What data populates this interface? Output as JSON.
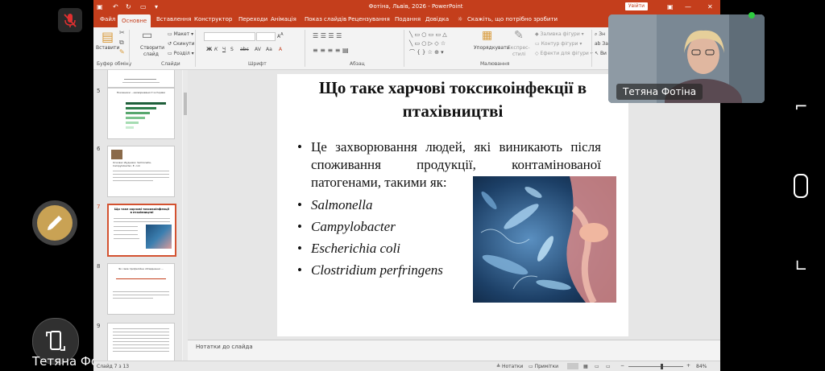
{
  "window": {
    "title": "Фотіна, Львів, 2026  -  PowerPoint",
    "share_button": "Увійти"
  },
  "ribbon_tabs": [
    "Файл",
    "Основне",
    "Вставлення",
    "Конструктор",
    "Переходи",
    "Анімація",
    "Показ слайдів",
    "Рецензування",
    "Подання",
    "Довідка"
  ],
  "active_tab": "Основне",
  "tell_me": "Скажіть, що потрібно зробити",
  "ribbon": {
    "paste": "Вставити",
    "new_slide_1": "Створити",
    "new_slide_2": "слайд",
    "layout": "Макет",
    "reset": "Скинути",
    "section": "Розділ",
    "arrange": "Упорядкувати",
    "quick_styles_1": "Експрес-",
    "quick_styles_2": "стилі",
    "shape_fill": "Заливка фігури",
    "shape_outline": "Контур фігури",
    "shape_effects": "Ефекти для фігури",
    "find": "Зн",
    "replace": "За",
    "select": "Ви",
    "groups": {
      "clipboard": "Буфер обміну",
      "slides": "Слайди",
      "font": "Шрифт",
      "paragraph": "Абзац",
      "drawing": "Малювання"
    }
  },
  "thumbnails": [
    {
      "num": "5",
      "title": "Показники ...захворюваності в Україні"
    },
    {
      "num": "6",
      "title": "Основні збудники: Salmonella, Campylobacter, E. coli"
    },
    {
      "num": "7",
      "title": "Що таке харчові токсикоінфекції в птахівництві"
    },
    {
      "num": "8",
      "title": "Як саме професійне обладнання ..."
    },
    {
      "num": "9",
      "title": ""
    }
  ],
  "slide": {
    "title": "Що таке харчові токсикоінфекції в птахівництві",
    "bullet_intro": "Це захворювання людей, які виникають після споживання продукції, контамінованої патогенами, такими як:",
    "pathogens": [
      "Salmonella",
      "Campylobacter",
      "Escherichia coli",
      "Clostridium perfringens"
    ],
    "bullet_char": "•"
  },
  "notes_placeholder": "Нотатки до слайда",
  "status": {
    "slide_info": "Слайд 7 з 13",
    "notes": "Нотатки",
    "comments": "Примітки",
    "zoom": "84%"
  },
  "video": {
    "participant_name": "Тетяна Фотіна",
    "self_name": "Тетяна Фотіна",
    "self_name_overflow": "ен"
  },
  "colors": {
    "accent": "#c43e1c",
    "selected_thumb": "#d35230",
    "video_active_dot": "#2ecc40",
    "mic_muted": "#e03030"
  }
}
